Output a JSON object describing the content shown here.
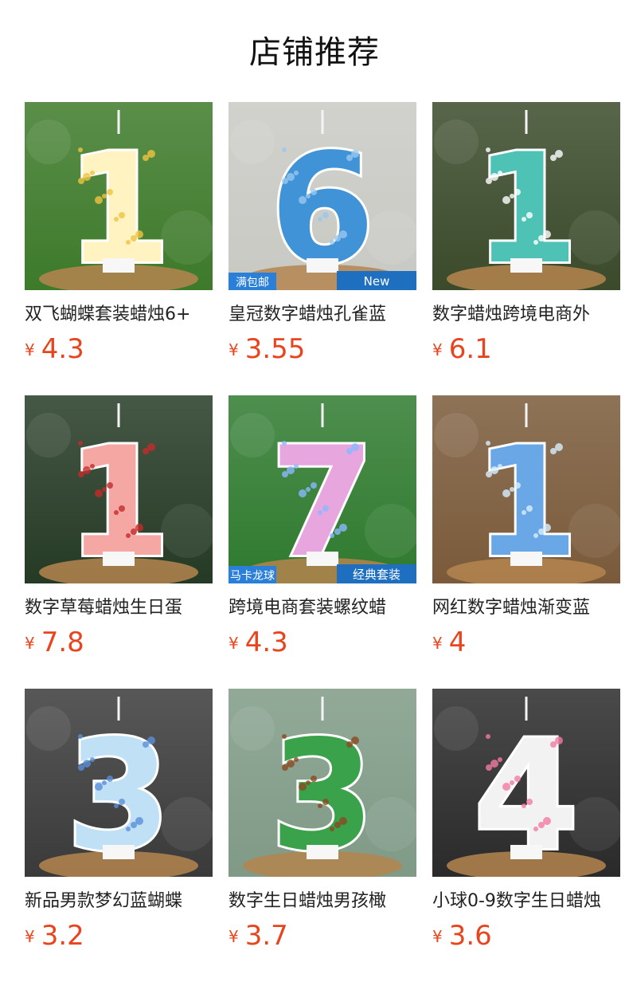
{
  "page": {
    "title": "店铺推荐"
  },
  "currency_symbol": "¥",
  "products": [
    {
      "name": "双飞蝴蝶套装蜡烛6+",
      "price": "4.3",
      "image": {
        "bg": "#3d7a2a",
        "candle": "#fff3c2",
        "accent": "#f0c340",
        "digit": "1",
        "badges": []
      }
    },
    {
      "name": "皇冠数字蜡烛孔雀蓝",
      "price": "3.55",
      "image": {
        "bg": "#c9c9c4",
        "candle": "#3f93d6",
        "accent": "#9ac8f0",
        "digit": "6",
        "badges": [
          "满包邮",
          "New"
        ]
      }
    },
    {
      "name": "数字蜡烛跨境电商外",
      "price": "6.1",
      "image": {
        "bg": "#3a4a2a",
        "candle": "#4fc2b6",
        "accent": "#ffffff",
        "digit": "1",
        "badges": []
      }
    },
    {
      "name": "数字草莓蜡烛生日蛋",
      "price": "7.8",
      "image": {
        "bg": "#253a25",
        "candle": "#f5a7a4",
        "accent": "#c42b2b",
        "digit": "1",
        "badges": []
      }
    },
    {
      "name": "跨境电商套装螺纹蜡",
      "price": "4.3",
      "image": {
        "bg": "#2f7a2f",
        "candle": "#e7a6de",
        "accent": "#8ab8ff",
        "digit": "7",
        "badges": [
          "马卡龙球",
          "经典套装"
        ]
      }
    },
    {
      "name": "网红数字蜡烛渐变蓝",
      "price": "4",
      "image": {
        "bg": "#7a5a3a",
        "candle": "#6aa7e6",
        "accent": "#d7efff",
        "digit": "1",
        "badges": []
      }
    },
    {
      "name": "新品男款梦幻蓝蝴蝶",
      "price": "3.2",
      "image": {
        "bg": "#3a3a3a",
        "candle": "#bfe0f5",
        "accent": "#5a8fd8",
        "digit": "3",
        "badges": []
      }
    },
    {
      "name": "数字生日蜡烛男孩橄",
      "price": "3.7",
      "image": {
        "bg": "#7f9a86",
        "candle": "#3aa24a",
        "accent": "#8b4a22",
        "digit": "3",
        "badges": []
      }
    },
    {
      "name": "小球0-9数字生日蜡烛",
      "price": "3.6",
      "image": {
        "bg": "#2a2a2a",
        "candle": "#f2f2f2",
        "accent": "#f07aa0",
        "digit": "4",
        "badges": []
      }
    }
  ]
}
